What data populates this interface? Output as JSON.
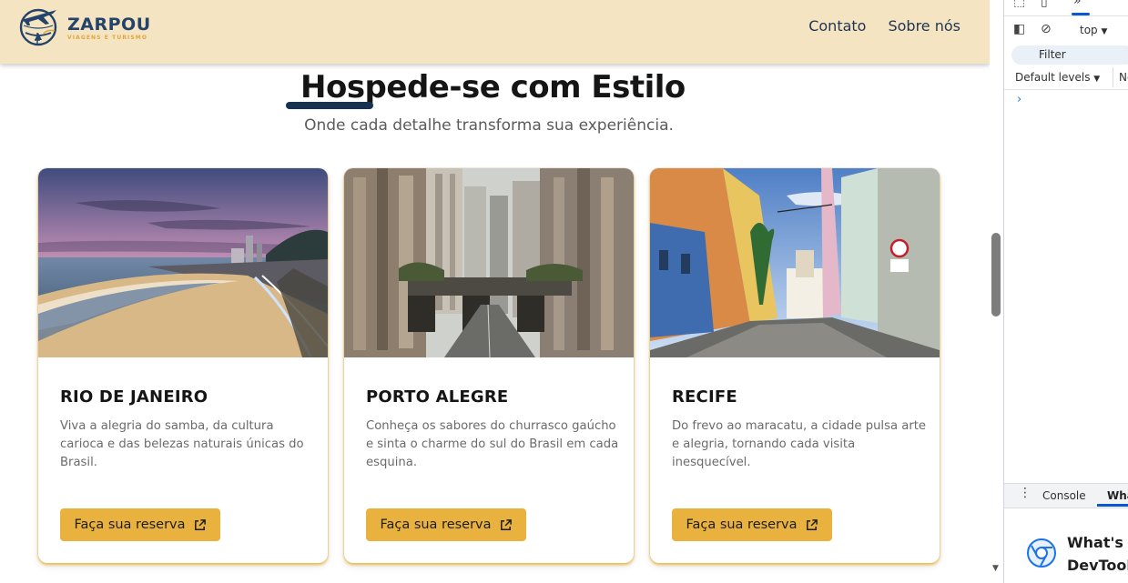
{
  "brand": {
    "name": "ZARPOU",
    "tagline": "VIAGENS E TURISMO"
  },
  "nav": {
    "links": [
      "Contato",
      "Sobre nós"
    ]
  },
  "hero": {
    "title": "Hospede-se com Estilo",
    "subtitle": "Onde cada detalhe transforma sua experiência."
  },
  "cards": [
    {
      "title": "RIO DE JANEIRO",
      "description": "Viva a alegria do samba, da cultura carioca e das belezas naturais únicas do Brasil.",
      "button_label": "Faça sua reserva",
      "image": "rio-de-janeiro-beach-photo"
    },
    {
      "title": "PORTO ALEGRE",
      "description": "Conheça os sabores do churrasco gaúcho e sinta o charme do sul do Brasil em cada esquina.",
      "button_label": "Faça sua reserva",
      "image": "porto-alegre-street-photo"
    },
    {
      "title": "RECIFE",
      "description": "Do frevo ao maracatu, a cidade pulsa arte e alegria, tornando cada visita inesquecível.",
      "button_label": "Faça sua reserva",
      "image": "recife-colonial-street-photo"
    }
  ],
  "colors": {
    "navbar_bg": "#f5e4c1",
    "brand_blue": "#23436a",
    "accent_gold": "#e9b23f",
    "title_underline": "#17324f"
  },
  "devtools": {
    "context": "top",
    "filter_placeholder": "Filter",
    "levels": "Default levels",
    "truncated_next": "Ne",
    "drawer_tabs": [
      "Console",
      "What's new"
    ],
    "drawer_tab_visible": "Wha",
    "whats_new_title_line1": "What's n",
    "whats_new_title_line2": "DevTools"
  }
}
